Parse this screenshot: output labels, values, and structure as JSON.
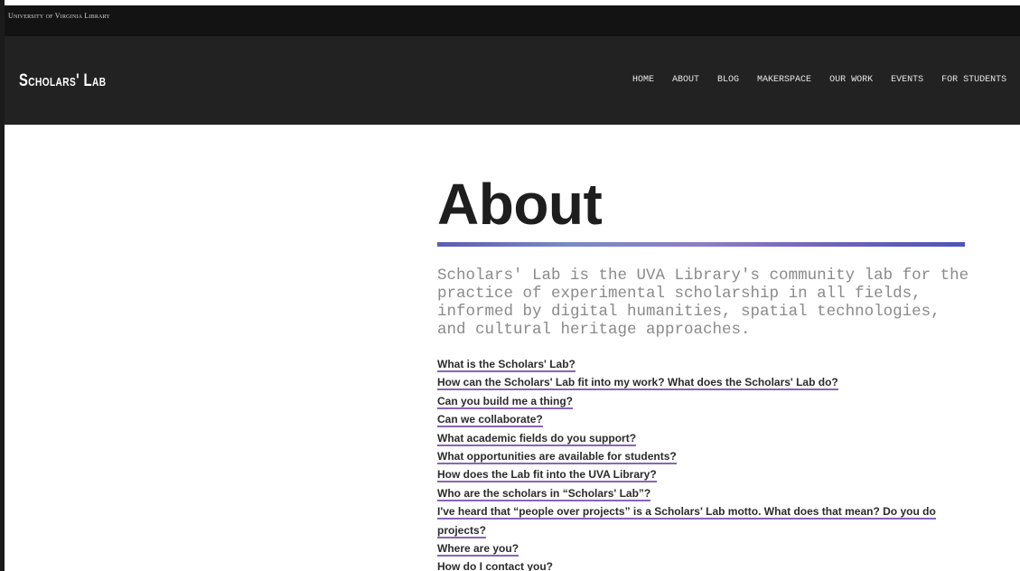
{
  "top_bar": {
    "university_link": "University of Virginia Library"
  },
  "header": {
    "logo": "Scholars' Lab",
    "nav": [
      "HOME",
      "ABOUT",
      "BLOG",
      "MAKERSPACE",
      "OUR WORK",
      "EVENTS",
      "FOR STUDENTS"
    ]
  },
  "main": {
    "title": "About",
    "intro": "Scholars' Lab is the UVA Library's community lab for the practice of experimental scholarship in all fields, informed by digital humanities, spatial technologies, and cultural heritage approaches.",
    "faq_links": [
      "What is the Scholars' Lab?",
      "How can the Scholars' Lab fit into my work? What does the Scholars' Lab do?",
      "Can you build me a thing?",
      "Can we collaborate?",
      "What academic fields do you support?",
      "What opportunities are available for students?",
      "How does the Lab fit into the UVA Library?",
      "Who are the scholars in “Scholars' Lab”?",
      "I've heard that “people over projects” is a Scholars' Lab motto. What does that mean? Do you do projects?",
      "Where are you?",
      "How do I contact you?"
    ]
  }
}
